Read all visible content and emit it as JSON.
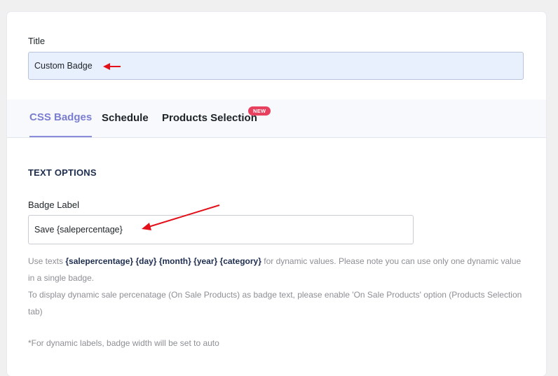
{
  "title_field": {
    "label": "Title",
    "value": "Custom Badge"
  },
  "tabs": [
    {
      "label": "CSS Badges",
      "active": true
    },
    {
      "label": "Schedule",
      "active": false
    },
    {
      "label": "Products Selection",
      "active": false,
      "badge": "NEW"
    }
  ],
  "text_options": {
    "heading": "TEXT OPTIONS",
    "badge_label": "Badge Label",
    "badge_value": "Save {salepercentage}",
    "help_prefix": "Use texts",
    "tokens": [
      "{salepercentage}",
      "{day}",
      "{month}",
      "{year}",
      "{category}"
    ],
    "help_suffix": "for dynamic values. Please note you can use only one dynamic value in a single badge.",
    "help_line2": "To display dynamic sale percenatage (On Sale Products) as badge text, please enable 'On Sale Products' option (Products Selection tab)",
    "note": "*For dynamic labels, badge width will be set to auto"
  },
  "colors": {
    "accent": "#7b7ed1",
    "new_badge": "#e8415f",
    "annotation_arrow": "#e3101a",
    "heading": "#1d2d50"
  }
}
